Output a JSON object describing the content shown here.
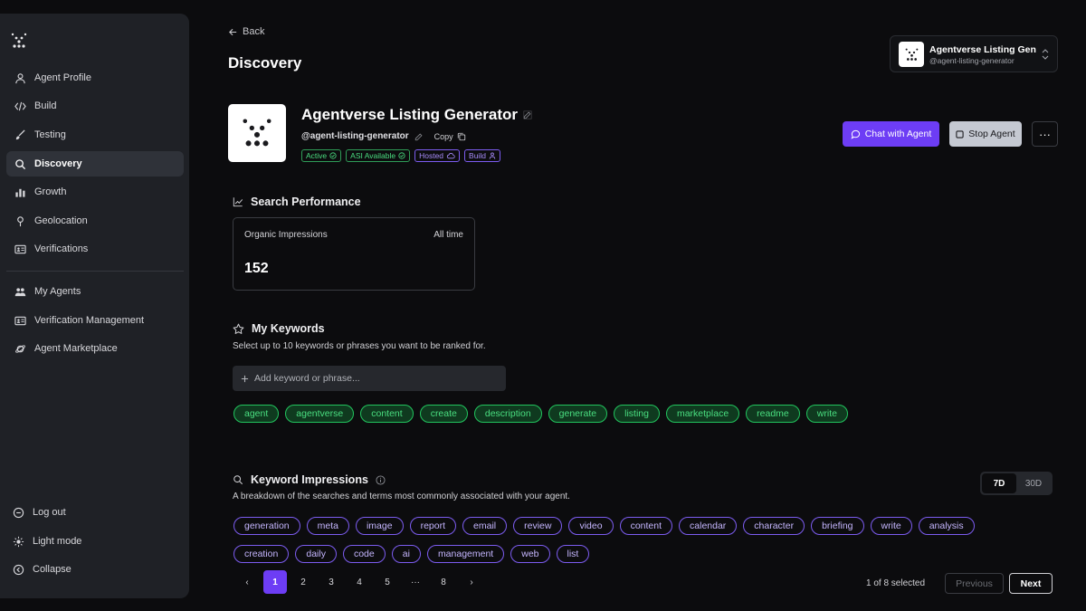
{
  "sidebar": {
    "items": [
      {
        "label": "Agent Profile",
        "icon": "user-icon"
      },
      {
        "label": "Build",
        "icon": "code-icon"
      },
      {
        "label": "Testing",
        "icon": "brush-icon"
      },
      {
        "label": "Discovery",
        "icon": "search-icon"
      },
      {
        "label": "Growth",
        "icon": "bar-chart-icon"
      },
      {
        "label": "Geolocation",
        "icon": "map-pin-icon"
      },
      {
        "label": "Verifications",
        "icon": "id-card-icon"
      },
      {
        "label": "My Agents",
        "icon": "users-icon"
      },
      {
        "label": "Verification Management",
        "icon": "id-card-icon"
      },
      {
        "label": "Agent Marketplace",
        "icon": "planet-icon"
      }
    ],
    "footer": [
      {
        "label": "Log out",
        "icon": "logout-icon"
      },
      {
        "label": "Light mode",
        "icon": "sun-icon"
      },
      {
        "label": "Collapse",
        "icon": "collapse-icon"
      }
    ]
  },
  "header": {
    "back_label": "Back",
    "title": "Discovery"
  },
  "switcher": {
    "name": "Agentverse Listing Gen",
    "handle": "@agent-listing-generator"
  },
  "agent": {
    "name": "Agentverse Listing Generator",
    "handle": "@agent-listing-generator",
    "copy_label": "Copy",
    "badges": [
      {
        "label": "Active",
        "color": "green"
      },
      {
        "label": "ASI Available",
        "color": "green"
      },
      {
        "label": "Hosted",
        "color": "purple"
      },
      {
        "label": "Build",
        "color": "purple"
      }
    ]
  },
  "actions": {
    "chat_label": "Chat with Agent",
    "stop_label": "Stop Agent",
    "more_label": "···"
  },
  "performance": {
    "title": "Search Performance",
    "card_label": "Organic Impressions",
    "range": "All time",
    "value": "152"
  },
  "keywords": {
    "title": "My Keywords",
    "subtitle": "Select up to 10 keywords or phrases you want to be ranked for.",
    "input_placeholder": "Add keyword or phrase...",
    "chips": [
      "agent",
      "agentverse",
      "content",
      "create",
      "description",
      "generate",
      "listing",
      "marketplace",
      "readme",
      "write"
    ]
  },
  "impressions": {
    "title": "Keyword Impressions",
    "subtitle": "A breakdown of the searches and terms most commonly associated with your agent.",
    "range_options": [
      "7D",
      "30D"
    ],
    "selected_range": "7D",
    "chips_row1": [
      "generation",
      "meta",
      "image",
      "report",
      "email",
      "review",
      "video",
      "content",
      "calendar",
      "character",
      "briefing",
      "write",
      "analysis"
    ],
    "chips_row2": [
      "creation",
      "daily",
      "code",
      "ai",
      "management",
      "web",
      "list"
    ]
  },
  "pagination": {
    "prev_arrow": "‹",
    "next_arrow": "›",
    "pages": [
      "1",
      "2",
      "3",
      "4",
      "5",
      "···",
      "8"
    ],
    "current": "1",
    "selected_text": "1 of 8 selected",
    "previous_label": "Previous",
    "next_label": "Next"
  },
  "colors": {
    "accent": "#6d3df5",
    "green": "#4ade80",
    "purple": "#a78bfa"
  }
}
